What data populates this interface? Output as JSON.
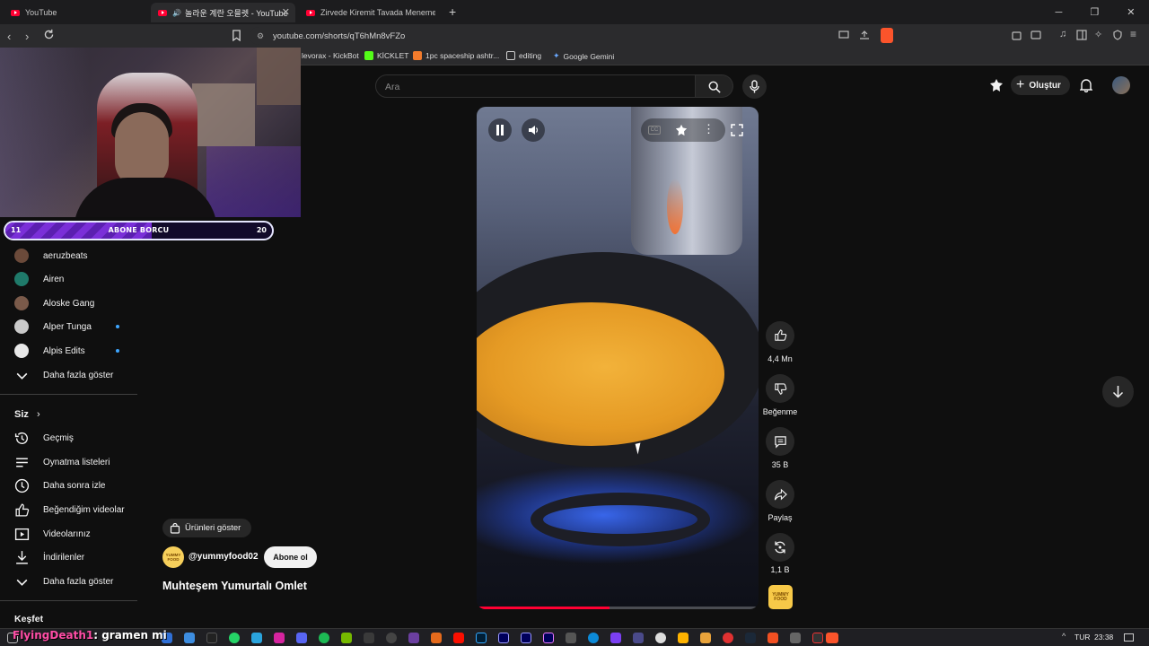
{
  "browser": {
    "tabs": [
      {
        "title": "YouTube"
      },
      {
        "title": "놀라운 계란 오믈렛 - YouTube"
      },
      {
        "title": "Zirvede Kiremit Tavada Menemen - C"
      }
    ],
    "url": "youtube.com/shorts/qT6hMn8vFZo",
    "bookmarks": [
      "levorax - KickBot",
      "KİCKLET",
      "1pc spaceship ashtr...",
      "editing",
      "Google Gemini"
    ]
  },
  "stream_overlay": {
    "sub_goal_current": "11",
    "sub_goal_title": "ABONE BORCU",
    "sub_goal_target": "20",
    "sub_goal_fraction": 0.55,
    "viewer_name": "FlyingDeath1",
    "viewer_text": "gramen mi"
  },
  "masthead": {
    "search_placeholder": "Ara",
    "create_label": "Oluştur"
  },
  "sidebar": {
    "subscriptions": [
      {
        "name": "aeruzbeats",
        "new": false,
        "avatar_color": "#6b4a3a"
      },
      {
        "name": "Airen",
        "new": false,
        "avatar_color": "#1f7a6a"
      },
      {
        "name": "Aloske Gang",
        "new": false,
        "avatar_color": "#7a5a4a"
      },
      {
        "name": "Alper Tunga",
        "new": true,
        "avatar_color": "#c9c9c9"
      },
      {
        "name": "Alpis Edits",
        "new": true,
        "avatar_color": "#e8e8e8"
      }
    ],
    "show_more_1": "Daha fazla göster",
    "you_heading": "Siz",
    "you_items": [
      {
        "label": "Geçmiş",
        "icon": "history-icon"
      },
      {
        "label": "Oynatma listeleri",
        "icon": "playlists-icon"
      },
      {
        "label": "Daha sonra izle",
        "icon": "watch-later-icon"
      },
      {
        "label": "Beğendiğim videolar",
        "icon": "liked-icon"
      },
      {
        "label": "Videolarınız",
        "icon": "your-videos-icon"
      },
      {
        "label": "İndirilenler",
        "icon": "downloads-icon"
      }
    ],
    "show_more_2": "Daha fazla göster",
    "explore_heading": "Keşfet"
  },
  "short": {
    "products_label": "Ürünleri göster",
    "channel_handle": "@yummyfood02",
    "channel_avatar_text": "YUMMY FOOD",
    "subscribe_label": "Abone ol",
    "title": "Muhteşem Yumurtalı Omlet",
    "progress_fraction": 0.47,
    "actions": {
      "like_count": "4,4 Mn",
      "dislike_label": "Beğenme",
      "comment_count": "35 B",
      "share_label": "Paylaş",
      "remix_count": "1,1 B"
    }
  },
  "taskbar": {
    "language": "TUR",
    "time": "23:38"
  }
}
